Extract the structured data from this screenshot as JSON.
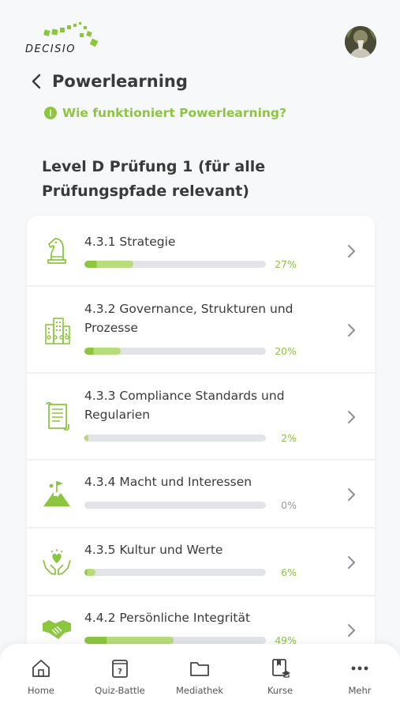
{
  "app": {
    "logo_text": "DECISIO"
  },
  "header": {
    "title": "Powerlearning"
  },
  "help_link": {
    "label": "Wie funktioniert Powerlearning?"
  },
  "section": {
    "title": "Level D Prüfung 1 (für alle Prüfungspfade relevant)"
  },
  "colors": {
    "accent": "#8cc63f",
    "accent_light": "#b7dc7c",
    "track": "#e2e4e7"
  },
  "modules": [
    {
      "title": "4.3.1 Strategie",
      "progress": 0.27,
      "percent_label": "27%",
      "icon": "chess-knight-icon"
    },
    {
      "title": "4.3.2 Governance, Strukturen und Prozesse",
      "progress": 0.2,
      "percent_label": "20%",
      "icon": "buildings-icon"
    },
    {
      "title": "4.3.3 Compliance Standards und Regularien",
      "progress": 0.02,
      "percent_label": "2%",
      "icon": "scroll-icon"
    },
    {
      "title": "4.3.4 Macht und Interessen",
      "progress": 0.0,
      "percent_label": "0%",
      "icon": "mountain-flag-icon"
    },
    {
      "title": "4.3.5 Kultur und Werte",
      "progress": 0.06,
      "percent_label": "6%",
      "icon": "hands-heart-icon"
    },
    {
      "title": "4.4.2 Persönliche Integrität",
      "progress": 0.49,
      "percent_label": "49%",
      "icon": "handshake-icon"
    }
  ],
  "tabbar": [
    {
      "label": "Home",
      "icon": "home-icon"
    },
    {
      "label": "Quiz-Battle",
      "icon": "quiz-card-icon"
    },
    {
      "label": "Mediathek",
      "icon": "folder-icon"
    },
    {
      "label": "Kurse",
      "icon": "course-book-icon"
    },
    {
      "label": "Mehr",
      "icon": "more-dots-icon"
    }
  ]
}
